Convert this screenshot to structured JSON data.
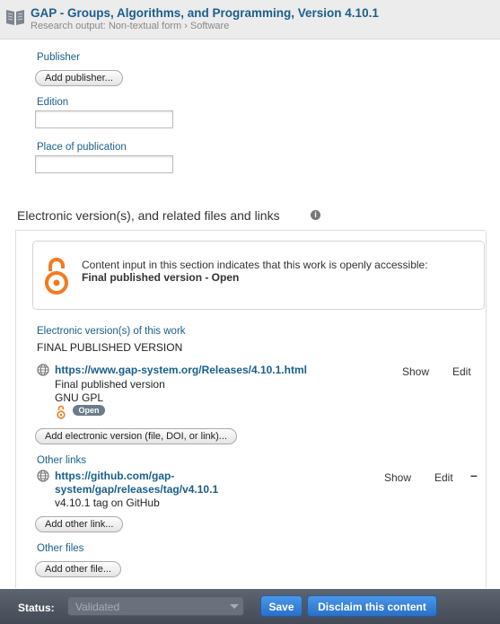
{
  "header": {
    "title": "GAP - Groups, Algorithms, and Programming, Version 4.10.1",
    "subtitle": "Research output: Non-textual form › Software"
  },
  "publisher": {
    "label": "Publisher",
    "add_button": "Add publisher..."
  },
  "edition": {
    "label": "Edition",
    "value": ""
  },
  "place": {
    "label": "Place of publication",
    "value": ""
  },
  "electronic_section": {
    "title": "Electronic version(s), and related files and links",
    "info_icon": "i",
    "notice_text": "Content input in this section indicates that this work is openly accessible:",
    "notice_status": "Final published version - Open"
  },
  "versions": {
    "label": "Electronic version(s) of this work",
    "group_heading": "FINAL PUBLISHED VERSION",
    "items": [
      {
        "url": "https://www.gap-system.org/Releases/4.10.1.html",
        "desc": "Final published version",
        "license": "GNU GPL",
        "badge": "Open",
        "show": "Show",
        "edit": "Edit"
      }
    ],
    "add_button": "Add electronic version (file, DOI, or link)..."
  },
  "other_links": {
    "label": "Other links",
    "items": [
      {
        "url_line1": "https://github.com/gap-",
        "url_line2": "system/gap/releases/tag/v4.10.1",
        "desc": "v4.10.1 tag on GitHub",
        "show": "Show",
        "edit": "Edit",
        "remove": "–"
      }
    ],
    "add_button": "Add other link..."
  },
  "other_files": {
    "label": "Other files",
    "add_button": "Add other file..."
  },
  "status_bar": {
    "label": "Status:",
    "value": "Validated",
    "save": "Save",
    "disclaim": "Disclaim this content"
  },
  "colors": {
    "link": "#1a5e8c",
    "open_access": "#f57a1f",
    "primary_button": "#2a6fc8"
  }
}
